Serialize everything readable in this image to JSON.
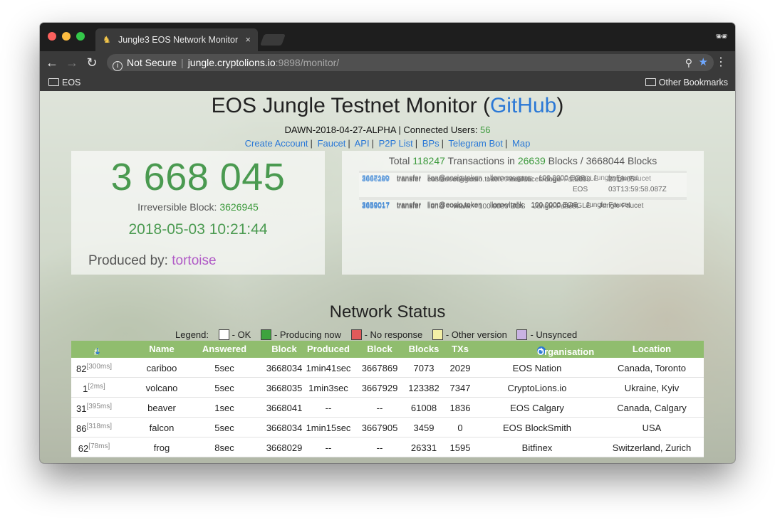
{
  "browser": {
    "tab_title": "Jungle3 EOS Network Monitor",
    "tab_close": "×",
    "nav_back": "←",
    "nav_forward": "→",
    "nav_reload": "↻",
    "info_icon": "i",
    "security_label": "Not Secure",
    "url_host": "jungle.cryptolions.io",
    "url_rest": ":9898/monitor/",
    "search_glyph": "⚲",
    "star_glyph": "★",
    "menu_glyph": "⋮",
    "incognito_glyph": "🕶",
    "favicon_glyph": "♞",
    "bookmarks": {
      "left": "EOS",
      "right": "Other Bookmarks"
    }
  },
  "header": {
    "title_prefix": "EOS Jungle Testnet Monitor (",
    "title_link": "GitHub",
    "title_suffix": ")",
    "version": "DAWN-2018-04-27-ALPHA",
    "connected_label": " | Connected Users: ",
    "connected_users": "56",
    "links": [
      "Create Account",
      "Faucet",
      "API",
      "P2P List",
      "BPs",
      "Telegram Bot",
      "Map"
    ],
    "link_separator": "|"
  },
  "block_info": {
    "head_block": "3 668 045",
    "irreversible_label": "Irreversible Block: ",
    "irreversible_block": "3626945",
    "timestamp": "2018-05-03 10:21:44",
    "produced_label": "Produced by: ",
    "producer": "tortoise"
  },
  "tx_summary": {
    "prefix": "Total ",
    "total_tx": "118247",
    "mid": " Transactions in ",
    "blocks_with_tx": "26639",
    "suffix": " Blocks / 3668044 Blocks"
  },
  "transactions": [
    {
      "block": "3667110",
      "action": "transfer",
      "details": "lion@eosio.token    lion>cougars    100.0000 EOS    Jungle Faucet"
    },
    {
      "block": "3667109",
      "action": "transfer",
      "details": "lion@eosio.token    lion>cougars    100.0000 JUNGLE    Jungle Faucet"
    },
    {
      "block": "3667109",
      "action": "transfer",
      "details": "lion->    cougars    100.0000 EOS    Jungle Faucet"
    },
    {
      "block": "3666287",
      "action": "transfer",
      "details": "eosfaucet@eosio.token    eosfaucet>dogo    1.0000",
      "details2": "EOS",
      "extra": "2018-05-",
      "extra2": "03T13:59:58.087Z"
    },
    {
      "block": "3659017",
      "action": "transfer",
      "details": "lion@eosio.token    lion>vitalik    100.0000 EOS    Jungle Faucet"
    },
    {
      "block": "3659017",
      "action": "transfer",
      "details": "lion@eosio.token    lion>vitalik    100.0000 JUNGLE    Jungle Faucet"
    },
    {
      "block": "3659017",
      "action": "transfer",
      "details": "lion->    vitalik    100.0000 EOS    Jungle Faucet"
    }
  ],
  "network": {
    "heading": "Network Status",
    "legend_label": "Legend:",
    "legend": [
      {
        "label": "- OK",
        "color": "#ffffff"
      },
      {
        "label": "- Producing now",
        "color": "#3ea33e"
      },
      {
        "label": "- No response",
        "color": "#e25a5a"
      },
      {
        "label": "- Other version",
        "color": "#f3f0a6"
      },
      {
        "label": "- Unsynced",
        "color": "#c9b3e3"
      }
    ],
    "columns": [
      "#",
      "Name",
      "Answered",
      "Block",
      "Produced",
      "Block",
      "Blocks",
      "TXs",
      "Organisation",
      "Location"
    ],
    "rows": [
      {
        "num": "82",
        "ping": "[300ms]",
        "name": "cariboo",
        "answered": "5sec",
        "block": "3668034",
        "produced": "1min41sec",
        "prod_block": "3667869",
        "blocks": "7073",
        "txs": "2029",
        "org": "EOS Nation",
        "location": "Canada, Toronto"
      },
      {
        "num": "1",
        "ping": "[2ms]",
        "name": "volcano",
        "answered": "5sec",
        "block": "3668035",
        "produced": "1min3sec",
        "prod_block": "3667929",
        "blocks": "123382",
        "txs": "7347",
        "org": "CryptoLions.io",
        "location": "Ukraine, Kyiv"
      },
      {
        "num": "31",
        "ping": "[395ms]",
        "name": "beaver",
        "answered": "1sec",
        "block": "3668041",
        "produced": "--",
        "prod_block": "--",
        "blocks": "61008",
        "txs": "1836",
        "org": "EOS Calgary",
        "location": "Canada, Calgary"
      },
      {
        "num": "86",
        "ping": "[318ms]",
        "name": "falcon",
        "answered": "5sec",
        "block": "3668034",
        "produced": "1min15sec",
        "prod_block": "3667905",
        "blocks": "3459",
        "txs": "0",
        "org": "EOS BlockSmith",
        "location": "USA"
      },
      {
        "num": "62",
        "ping": "[78ms]",
        "name": "frog",
        "answered": "8sec",
        "block": "3668029",
        "produced": "--",
        "prod_block": "--",
        "blocks": "26331",
        "txs": "1595",
        "org": "Bitfinex",
        "location": "Switzerland, Zurich"
      }
    ]
  }
}
